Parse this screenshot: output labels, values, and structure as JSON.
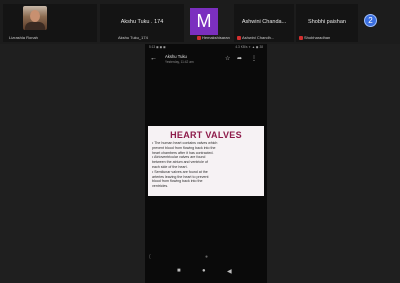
{
  "participants": [
    {
      "name": "Lizrashla Ronah",
      "kind": "photo"
    },
    {
      "name": "Akshu Tuku_174",
      "display": "Akshu Tuku . 174"
    },
    {
      "name": "Hemakshisaran",
      "kind": "letter",
      "letter": "M",
      "color": "#7b2fbf"
    },
    {
      "name": "Ashwini Chandh...",
      "display": "Ashwini Chanda..."
    },
    {
      "name": "Shobharadhan",
      "display": "Shobhi paishan"
    }
  ],
  "more_button": {
    "label": "2"
  },
  "phone": {
    "status_left": "5:13 ◼ ◼ ◼",
    "status_right": "4.3 KB/s ✦ ▲ ◼ 38",
    "app": {
      "back": "←",
      "title": "Akshu Tuku",
      "subtitle": "Yesterday, 11:42 am",
      "icons": {
        "star": "☆",
        "share": "➦",
        "menu": "⋮"
      }
    },
    "slide": {
      "heading": "HEART VALVES",
      "lines": [
        "• The human heart contains valves which",
        "  prevent blood from flowing back into the",
        "  heart chambers after it has contracted.",
        "• Atrioventricular valves are found",
        "  between the atrium and ventricle of",
        "  each side of the heart.",
        "• Semilunar valves are found at the",
        "  arteries leaving the heart to prevent",
        "  blood from flowing back into the",
        "  ventricles."
      ]
    },
    "nav": {
      "recent": "■",
      "home": "●",
      "back": "◀"
    }
  }
}
